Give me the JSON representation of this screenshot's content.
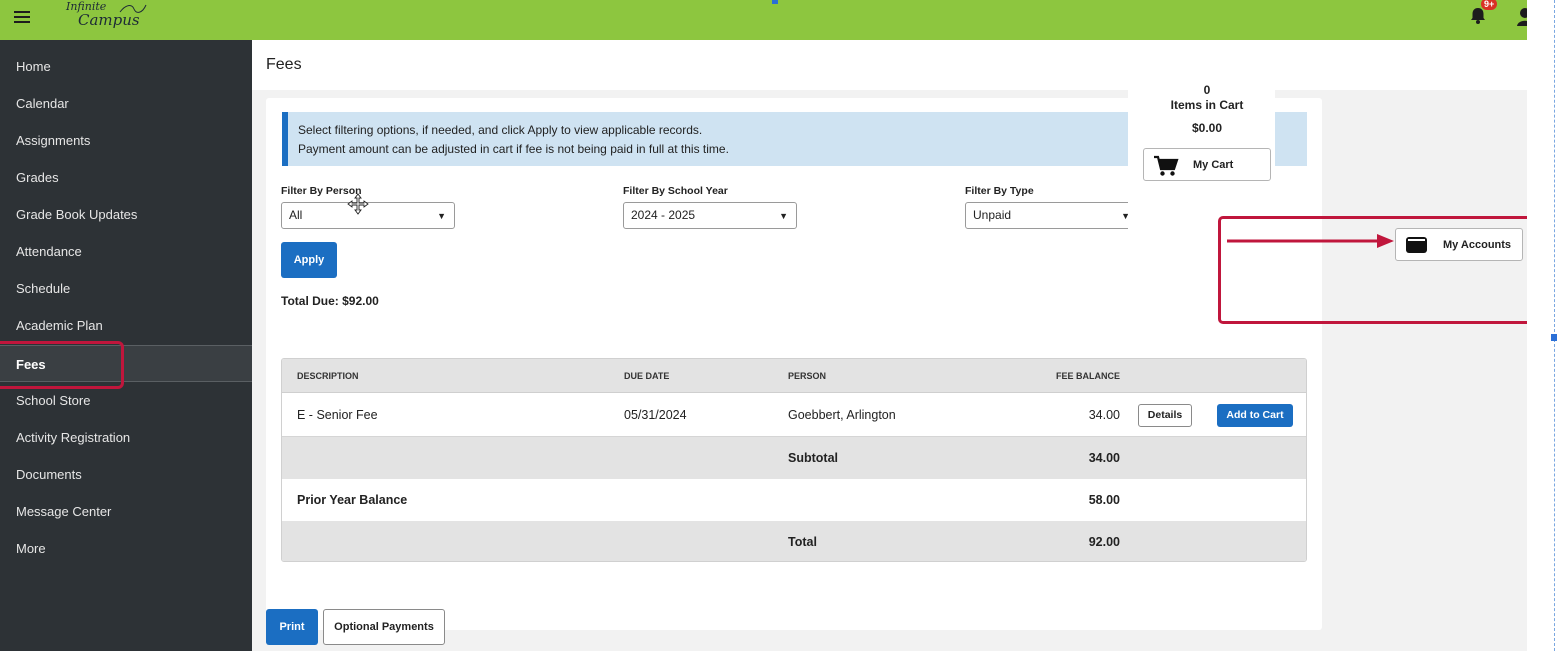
{
  "app": {
    "logo_line1": "Infinite",
    "logo_line2": "Campus",
    "notification_badge": "9+"
  },
  "sidebar": {
    "items": [
      {
        "label": "Home"
      },
      {
        "label": "Calendar"
      },
      {
        "label": "Assignments"
      },
      {
        "label": "Grades"
      },
      {
        "label": "Grade Book Updates"
      },
      {
        "label": "Attendance"
      },
      {
        "label": "Schedule"
      },
      {
        "label": "Academic Plan"
      },
      {
        "label": "Fees"
      },
      {
        "label": "School Store"
      },
      {
        "label": "Activity Registration"
      },
      {
        "label": "Documents"
      },
      {
        "label": "Message Center"
      },
      {
        "label": "More"
      }
    ],
    "active": "Fees"
  },
  "page": {
    "title": "Fees",
    "info_line1": "Select filtering options, if needed, and click Apply to view applicable records.",
    "info_line2": "Payment amount can be adjusted in cart if fee is not being paid in full at this time."
  },
  "filters": {
    "person_label": "Filter By Person",
    "person_value": "All",
    "year_label": "Filter By School Year",
    "year_value": "2024 - 2025",
    "type_label": "Filter By Type",
    "type_value": "Unpaid",
    "apply_label": "Apply"
  },
  "total_due": "Total Due: $92.00",
  "table": {
    "headers": {
      "description": "DESCRIPTION",
      "due_date": "DUE DATE",
      "person": "PERSON",
      "fee_balance": "FEE BALANCE"
    },
    "row": {
      "description": "E - Senior Fee",
      "due_date": "05/31/2024",
      "person": "Goebbert, Arlington",
      "balance": "34.00",
      "details_label": "Details",
      "add_label": "Add to Cart"
    },
    "subtotal": {
      "label": "Subtotal",
      "value": "34.00"
    },
    "prior": {
      "label": "Prior Year Balance",
      "value": "58.00"
    },
    "total": {
      "label": "Total",
      "value": "92.00"
    }
  },
  "footer": {
    "print_label": "Print",
    "optional_label": "Optional Payments"
  },
  "cart": {
    "count": "0",
    "count_label": "Items in Cart",
    "amount": "$0.00",
    "my_cart_label": "My Cart",
    "my_accounts_label": "My Accounts"
  },
  "colors": {
    "topbar": "#8dc63f",
    "sidebar": "#2d3236",
    "primary": "#1b6ec2",
    "annotation": "#c0163c"
  },
  "icons": [
    "menu-icon",
    "bell-icon",
    "user-icon",
    "cart-icon",
    "wallet-icon",
    "move-cursor-icon",
    "chevron-down-icon"
  ]
}
